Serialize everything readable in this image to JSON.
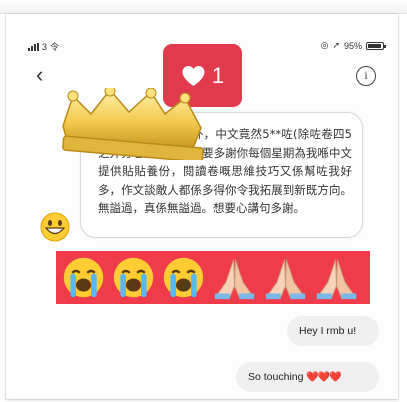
{
  "status_bar": {
    "carrier": "3",
    "network": "令",
    "battery_percent": "95%",
    "battery_level": 0.95
  },
  "nav": {
    "back_icon": "chevron-left-icon",
    "info_icon": "info-icon",
    "info_glyph": "i"
  },
  "reaction": {
    "icon": "heart-icon",
    "count": "1",
    "color": "#e23a4d"
  },
  "message": {
    "text": "你曾經講過我個名外，中文竟然5**咗(除咗卷四5之外分卷全部5**)，要多謝你每個星期為我喺中文提供貼貼養份，閱讀卷嘅思維技巧又係幫咗我好多，作文談敵人都係多得你令我拓展到新既方向。無謚過，真係無謚過。想要心講句多謝。"
  },
  "emoji_row": {
    "background": "#ef3b4a",
    "items": [
      "loudly-crying-face",
      "loudly-crying-face",
      "loudly-crying-face",
      "folded-hands",
      "folded-hands",
      "folded-hands"
    ]
  },
  "replies": [
    {
      "text": "Hey I rmb u!"
    },
    {
      "text": "So touching",
      "suffix": "❤️❤️❤️"
    }
  ]
}
